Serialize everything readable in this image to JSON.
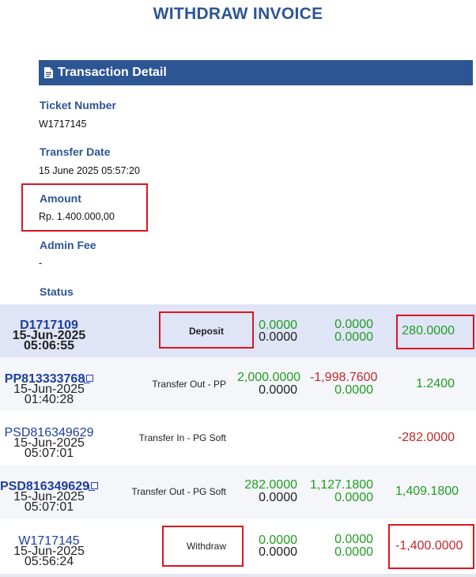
{
  "title": "WITHDRAW INVOICE",
  "section": {
    "label": "Transaction Detail",
    "icon": "document-icon"
  },
  "fields": {
    "ticket_label": "Ticket Number",
    "ticket_value": "W1717145",
    "transfer_label": "Transfer Date",
    "transfer_value": "15 June 2025 05:57:20",
    "amount_label": "Amount",
    "amount_value": "Rp. 1.400.000,00",
    "admin_label": "Admin Fee",
    "admin_value": "-",
    "status_label": "Status"
  },
  "transactions": [
    {
      "id": "D1717109",
      "date": "15-Jun-2025 05:06:55",
      "type": "Deposit",
      "a1": "0.0000",
      "a2": "0.0000",
      "b1": "0.0000",
      "b2": "0.0000",
      "total": "280.0000"
    },
    {
      "id": "PP813333768",
      "date": "15-Jun-2025 01:40:28",
      "type": "Transfer Out - PP",
      "a1": "2,000.0000",
      "a2": "0.0000",
      "b1": "-1,998.7600",
      "b2": "0.0000",
      "total": "1.2400"
    },
    {
      "id": "PSD816349629",
      "date": "15-Jun-2025 05:07:01",
      "type": "Transfer In - PG Soft",
      "total": "-282.0000"
    },
    {
      "id": "PSD816349629",
      "date": "15-Jun-2025 05:07:01",
      "type": "Transfer Out - PG Soft",
      "a1": "282.0000",
      "a2": "0.0000",
      "b1": "1,127.1800",
      "b2": "0.0000",
      "total": "1,409.1800"
    },
    {
      "id": "W1717145",
      "date": "15-Jun-2025 05:56:24",
      "type": "Withdraw",
      "a1": "0.0000",
      "a2": "0.0000",
      "b1": "0.0000",
      "b2": "0.0000",
      "total": "-1,400.0000"
    }
  ],
  "colors": {
    "primary": "#2c5593",
    "highlight": "#e0141e",
    "positive": "#1f9e1f",
    "negative": "#c0282b"
  }
}
